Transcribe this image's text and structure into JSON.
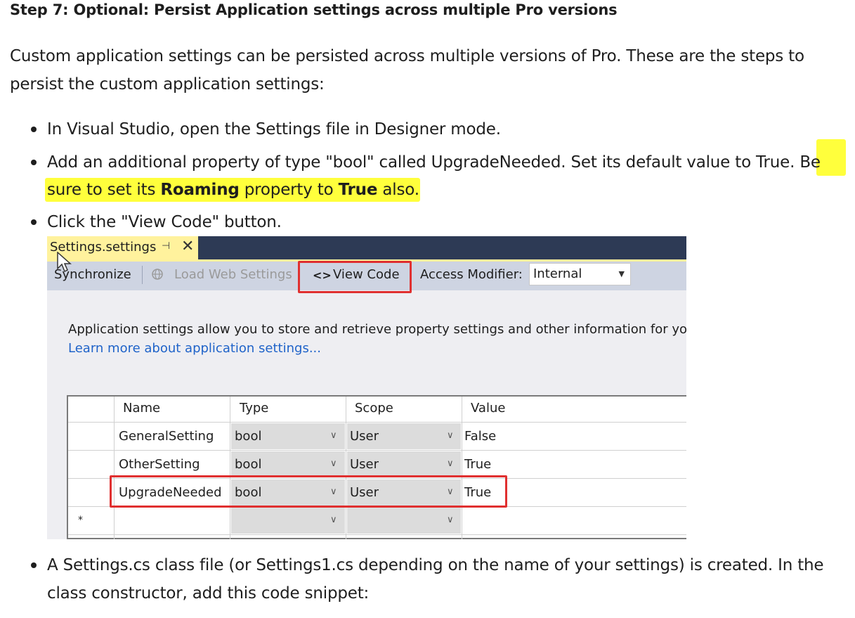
{
  "heading": "Step 7: Optional: Persist Application settings across multiple Pro versions",
  "intro": "Custom application settings can be persisted across multiple versions of Pro. These are the steps to persist the custom application settings:",
  "bullets": {
    "b1": "In Visual Studio, open the Settings file in Designer mode.",
    "b2_plain": "Add an additional property of type \"bool\" called UpgradeNeeded. Set its default value to True.",
    "b2_hl_a": "Be",
    "b2_hl_b": "sure to set its ",
    "b2_hl_bold1": "Roaming",
    "b2_hl_c": " property to ",
    "b2_hl_bold2": "True",
    "b2_hl_d": " also.",
    "b3": "Click the \"View Code\" button.",
    "b4_line1": "A Settings.cs class file (or Settings1.cs depending on the name of your settings) is created. In the",
    "b4_line2": "class constructor, add this code snippet:"
  },
  "screenshot": {
    "tab_title": "Settings.settings",
    "tab_pin": "⊣",
    "tab_close": "✕",
    "toolbar": {
      "synchronize": "Synchronize",
      "load_web": "Load Web Settings",
      "view_code": "View Code",
      "access_modifier_label": "Access Modifier:",
      "access_modifier_value": "Internal"
    },
    "description": "Application settings allow you to store and retrieve property settings and other information for you",
    "learn_more": "Learn more about application settings...",
    "grid": {
      "headers": [
        "Name",
        "Type",
        "Scope",
        "Value"
      ],
      "rows": [
        {
          "name": "GeneralSetting",
          "type": "bool",
          "scope": "User",
          "value": "False"
        },
        {
          "name": "OtherSetting",
          "type": "bool",
          "scope": "User",
          "value": "True"
        },
        {
          "name": "UpgradeNeeded",
          "type": "bool",
          "scope": "User",
          "value": "True"
        }
      ],
      "new_row_marker": "*"
    }
  },
  "colors": {
    "highlight": "#ffff3c",
    "callout": "#e03030",
    "link": "#1f63c9",
    "tab": "#fff29d"
  }
}
